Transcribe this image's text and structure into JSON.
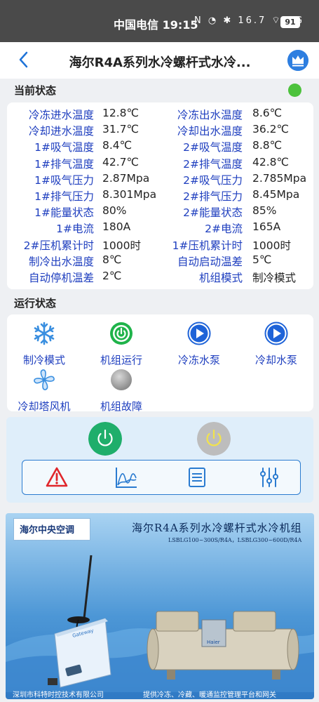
{
  "status_bar": {
    "text": "中国电信 19:15",
    "icons": "N ◔ ✱ 16.7 ⌔ 5G",
    "battery": "91"
  },
  "app_bar": {
    "title": "海尔R4A系列水冷螺杆式水冷..."
  },
  "current_status": {
    "title": "当前状态",
    "indicator_color": "#4cc23c",
    "params": [
      {
        "label": "冷冻进水温度",
        "value": "12.8℃"
      },
      {
        "label": "冷冻出水温度",
        "value": "8.6℃"
      },
      {
        "label": "冷却进水温度",
        "value": "31.7℃"
      },
      {
        "label": "冷却出水温度",
        "value": "36.2℃"
      },
      {
        "label": "1#吸气温度",
        "value": "8.4℃"
      },
      {
        "label": "2#吸气温度",
        "value": "8.8℃"
      },
      {
        "label": "1#排气温度",
        "value": "42.7℃"
      },
      {
        "label": "2#排气温度",
        "value": "42.8℃"
      },
      {
        "label": "1#吸气压力",
        "value": "2.87Mpa"
      },
      {
        "label": "2#吸气压力",
        "value": "2.785Mpa"
      },
      {
        "label": "1#排气压力",
        "value": "8.301Mpa"
      },
      {
        "label": "2#排气压力",
        "value": "8.45Mpa"
      },
      {
        "label": "1#能量状态",
        "value": "80%"
      },
      {
        "label": "2#能量状态",
        "value": "85%"
      },
      {
        "label": "1#电流",
        "value": "180A"
      },
      {
        "label": "2#电流",
        "value": "165A"
      },
      {
        "label": "2#压机累计时",
        "value": "1000时"
      },
      {
        "label": "1#压机累计时",
        "value": "1000时"
      },
      {
        "label": "制冷出水温度",
        "value": "8℃"
      },
      {
        "label": "自动启动温差",
        "value": "5℃"
      },
      {
        "label": "自动停机温差",
        "value": "2℃"
      },
      {
        "label": "机组模式",
        "value": "制冷模式"
      }
    ]
  },
  "run_status": {
    "title": "运行状态",
    "items": [
      {
        "label": "制冷模式",
        "icon": "snowflake-icon"
      },
      {
        "label": "机组运行",
        "icon": "power-on-icon"
      },
      {
        "label": "冷冻水泵",
        "icon": "pump-play-icon"
      },
      {
        "label": "冷却水泵",
        "icon": "pump-play-icon"
      },
      {
        "label": "冷却塔风机",
        "icon": "fan-icon"
      },
      {
        "label": "机组故障",
        "icon": "fault-indicator-icon"
      }
    ]
  },
  "controls": {
    "power_on_color": "#1fae6b",
    "power_off_color": "#bdbdbd",
    "tools": [
      "alarm-icon",
      "trend-chart-icon",
      "list-icon",
      "settings-sliders-icon"
    ]
  },
  "banner": {
    "brand": "海尔中央空调",
    "title": "海尔R4A系列水冷螺杆式水冷机组",
    "subtitle": "LSBLG100~300S/R4A，LSBLG300~600D/R4A",
    "gateway_label": "Gateway",
    "machine_brand": "Haier",
    "footer_left": "深圳市科特时控技术有限公司",
    "footer_right": "提供冷冻、冷藏、暖通监控管理平台和网关"
  }
}
